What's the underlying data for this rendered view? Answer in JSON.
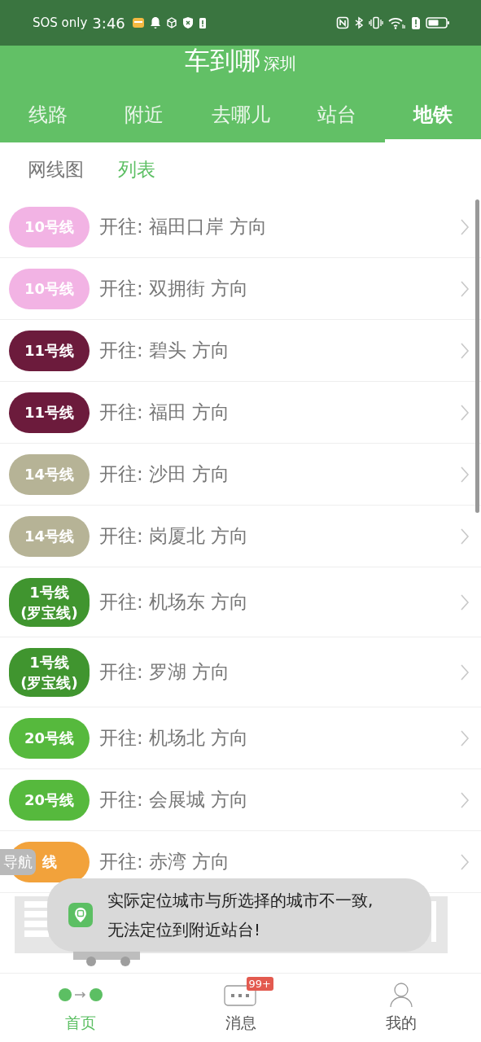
{
  "status_bar": {
    "carrier": "SOS only",
    "time": "3:46"
  },
  "header": {
    "title": "车到哪",
    "city": "深圳"
  },
  "tabs": [
    {
      "label": "线路",
      "selected": false
    },
    {
      "label": "附近",
      "selected": false
    },
    {
      "label": "去哪儿",
      "selected": false
    },
    {
      "label": "站台",
      "selected": false
    },
    {
      "label": "地铁",
      "selected": true
    }
  ],
  "subtabs": [
    {
      "label": "网线图",
      "selected": false
    },
    {
      "label": "列表",
      "selected": true
    }
  ],
  "routes": [
    {
      "badge": [
        "10号线"
      ],
      "color": "#f2b3e4",
      "direction": "开往: 福田口岸 方向"
    },
    {
      "badge": [
        "10号线"
      ],
      "color": "#f2b3e4",
      "direction": "开往: 双拥街 方向"
    },
    {
      "badge": [
        "11号线"
      ],
      "color": "#6c1b3c",
      "direction": "开往: 碧头 方向"
    },
    {
      "badge": [
        "11号线"
      ],
      "color": "#6c1b3c",
      "direction": "开往: 福田 方向"
    },
    {
      "badge": [
        "14号线"
      ],
      "color": "#b6b396",
      "direction": "开往: 沙田 方向"
    },
    {
      "badge": [
        "14号线"
      ],
      "color": "#b6b396",
      "direction": "开往: 岗厦北 方向"
    },
    {
      "badge": [
        "1号线",
        "(罗宝线)"
      ],
      "color": "#40952f",
      "direction": "开往: 机场东 方向"
    },
    {
      "badge": [
        "1号线",
        "(罗宝线)"
      ],
      "color": "#40952f",
      "direction": "开往: 罗湖 方向"
    },
    {
      "badge": [
        "20号线"
      ],
      "color": "#56b93d",
      "direction": "开往: 机场北 方向"
    },
    {
      "badge": [
        "20号线"
      ],
      "color": "#56b93d",
      "direction": "开往: 会展城 方向"
    },
    {
      "badge": [
        "线"
      ],
      "color": "#f2a23b",
      "direction": "开往: 赤湾 方向"
    }
  ],
  "nav_label": "导航",
  "toast": {
    "text": "实际定位城市与所选择的城市不一致,\n无法定位到附近站台!"
  },
  "bottom_nav": [
    {
      "label": "首页",
      "selected": true,
      "kind": "route"
    },
    {
      "label": "消息",
      "selected": false,
      "kind": "message",
      "badge": "99+"
    },
    {
      "label": "我的",
      "selected": false,
      "kind": "person"
    }
  ]
}
